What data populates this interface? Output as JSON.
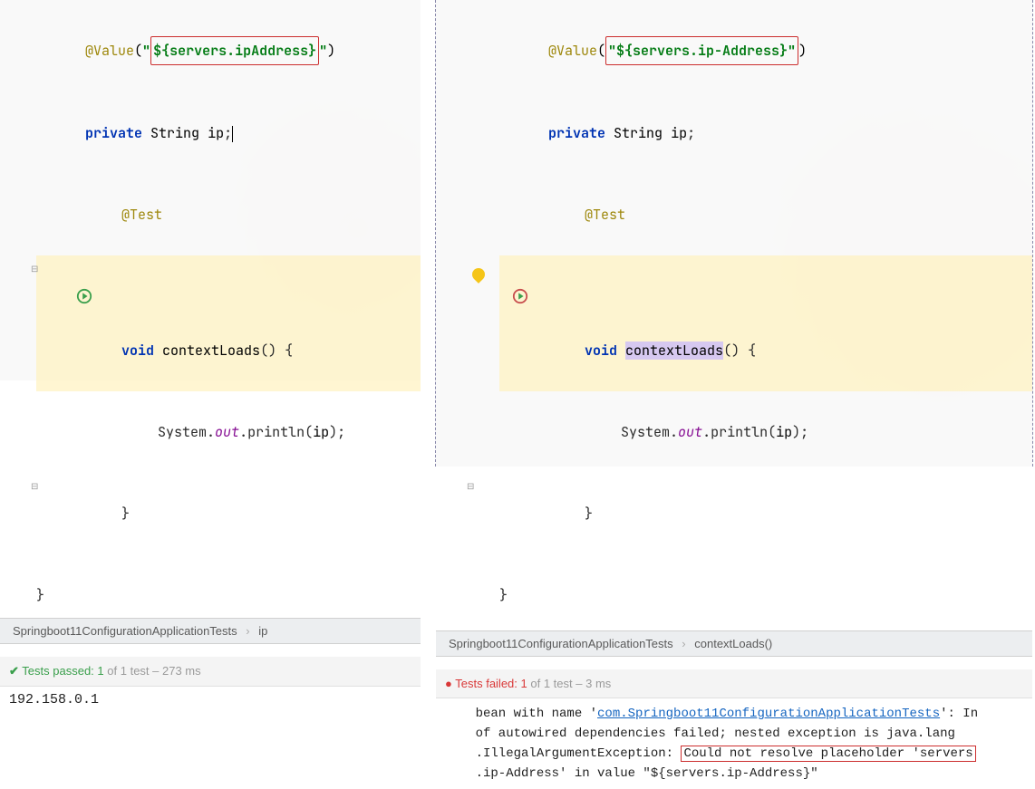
{
  "left": {
    "code": {
      "anno": "@Value",
      "value_q1": "\"",
      "value_prop": "${servers.ipAddress}",
      "value_q2": "\"",
      "decl_kw": "private",
      "decl_type": "String",
      "decl_name": "ip",
      "test_anno": "@Test",
      "method_kw": "void",
      "method_name": "contextLoads",
      "call_cls": "System",
      "call_field": "out",
      "call_fn": "println",
      "call_arg": "ip"
    },
    "breadcrumb": {
      "cls": "Springboot11ConfigurationApplicationTests",
      "member": "ip"
    },
    "testbar": {
      "label": "Tests passed:",
      "count": "1",
      "of": "of 1 test",
      "time": "– 273 ms"
    },
    "console": "192.158.0.1"
  },
  "right": {
    "code": {
      "anno": "@Value",
      "value_q1": "(",
      "value_full": "\"${servers.ip-Address}\"",
      "value_q2": ")",
      "decl_kw": "private",
      "decl_type": "String",
      "decl_name": "ip",
      "test_anno": "@Test",
      "method_kw": "void",
      "method_name": "contextLoads",
      "call_cls": "System",
      "call_field": "out",
      "call_fn": "println",
      "call_arg": "ip"
    },
    "breadcrumb": {
      "cls": "Springboot11ConfigurationApplicationTests",
      "member": "contextLoads()"
    },
    "testbar": {
      "label": "Tests failed:",
      "count": "1",
      "of": "of 1 test",
      "time": "– 3 ms"
    },
    "err": {
      "l1a": "    bean with name '",
      "l1_link": "com.Springboot11ConfigurationApplicationTests",
      "l1b": "': In",
      "l2": "    of autowired dependencies failed; nested exception is java.lang",
      "l3a": "    .IllegalArgumentException: ",
      "l3_box": "Could not resolve placeholder 'servers",
      "l4": "    .ip-Address' in value \"${servers.ip-Address}\""
    }
  }
}
